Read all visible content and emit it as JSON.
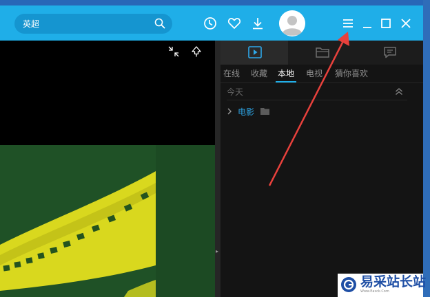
{
  "search": {
    "value": "英超",
    "placeholder": ""
  },
  "topbar_icons": [
    "history-icon",
    "favorite-heart-icon",
    "download-icon"
  ],
  "window_controls": [
    "menu-icon",
    "minimize-icon",
    "maximize-icon",
    "close-icon"
  ],
  "panel": {
    "top_tabs": [
      "playlist-icon",
      "folder-icon",
      "message-icon"
    ],
    "sub_tabs": [
      "在线",
      "收藏",
      "本地",
      "电视",
      "猜你喜欢"
    ],
    "active_sub_tab": "本地",
    "group_label": "今天",
    "folder_label": "电影"
  },
  "watermark": {
    "text": "易采站长站",
    "url": "Www.Easck.Com"
  },
  "colors": {
    "topbar": "#1faee8",
    "accent": "#2ea8ea",
    "panel_bg": "#141414",
    "annotation": "#e8413c",
    "film_green": "#1f5126",
    "film_yellow": "#d9d81e"
  }
}
